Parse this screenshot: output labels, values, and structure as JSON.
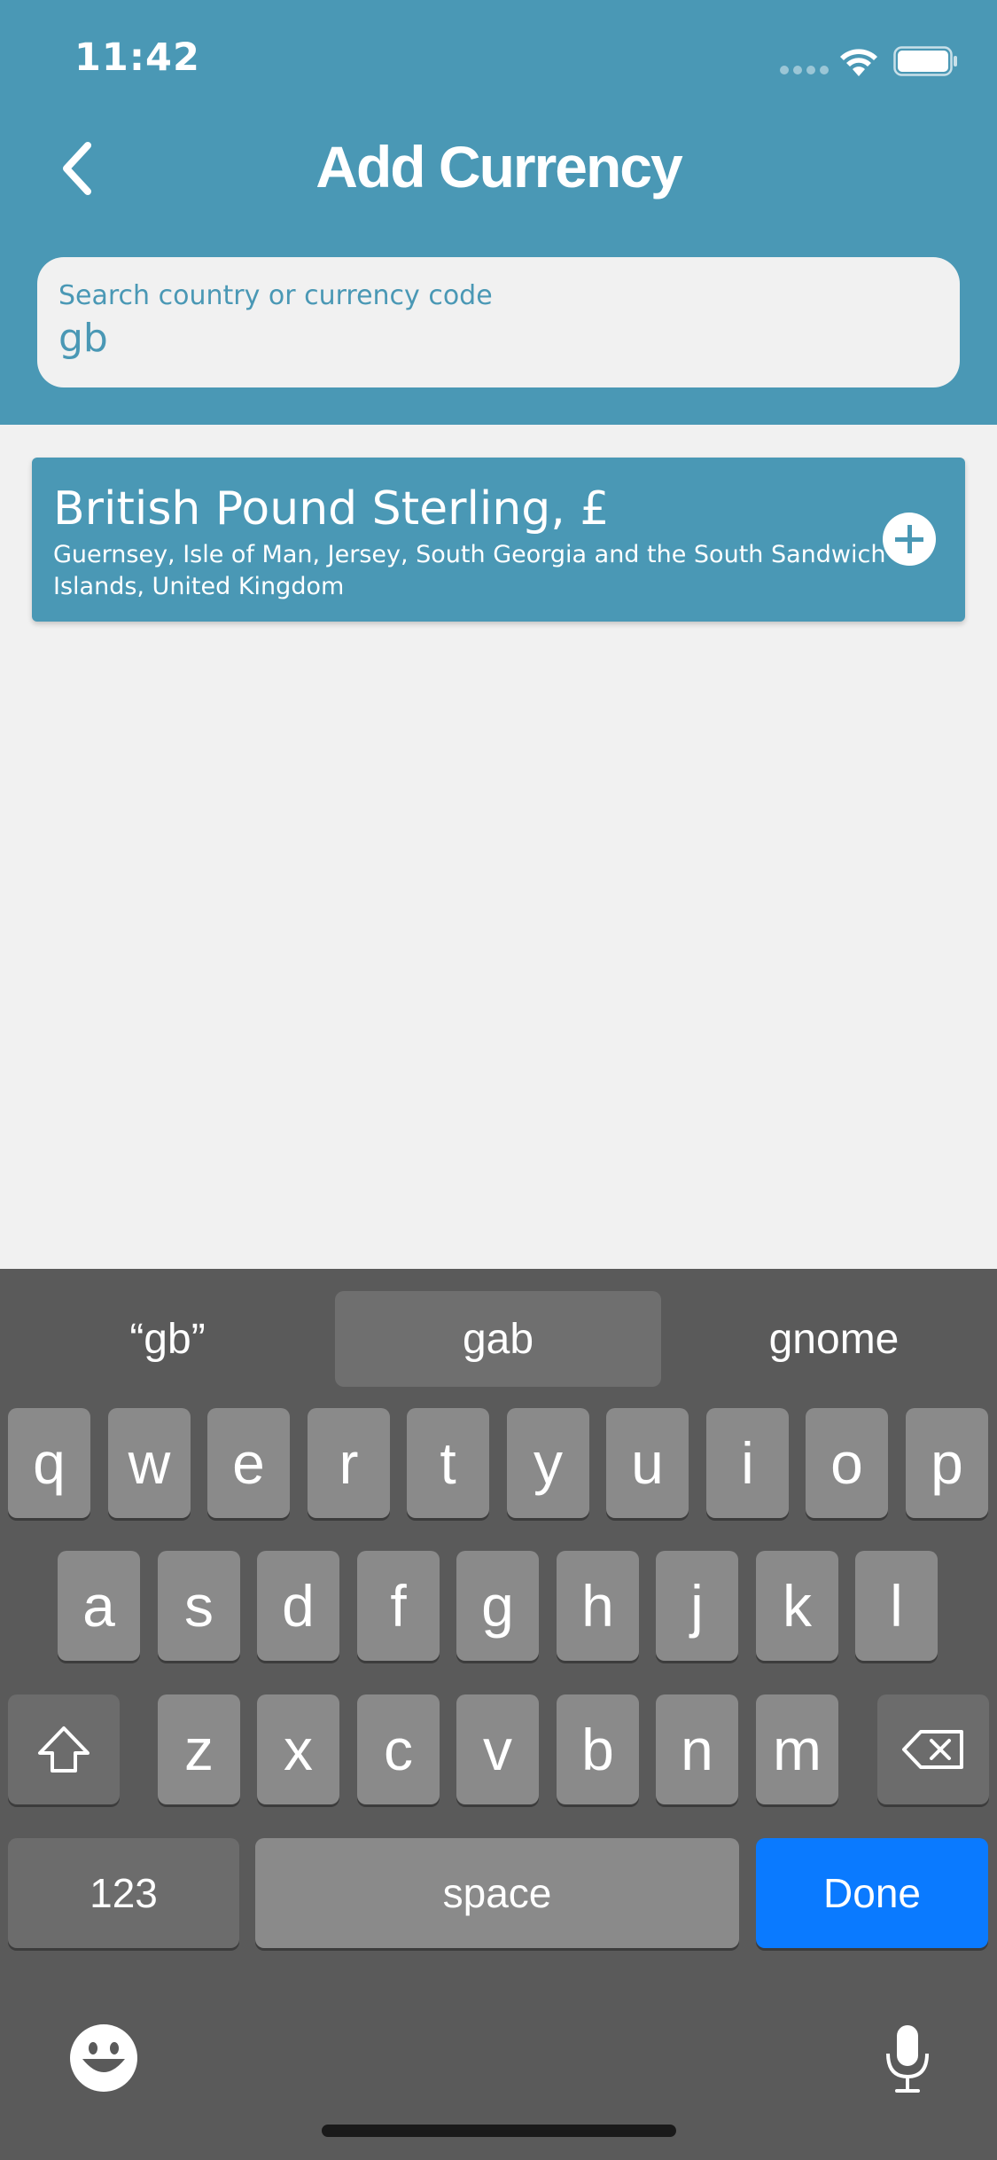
{
  "status_bar": {
    "time": "11:42"
  },
  "header": {
    "title": "Add Currency",
    "back_icon": "chevron-left-icon"
  },
  "search": {
    "label": "Search country or currency code",
    "value": "gb"
  },
  "results": [
    {
      "title": "British Pound Sterling, £",
      "countries": "Guernsey, Isle of Man, Jersey, South Georgia and the South Sandwich Islands, United Kingdom",
      "action_icon": "plus-circle-icon"
    }
  ],
  "keyboard": {
    "suggestions": [
      "“gb”",
      "gab",
      "gnome"
    ],
    "row1": [
      "q",
      "w",
      "e",
      "r",
      "t",
      "y",
      "u",
      "i",
      "o",
      "p"
    ],
    "row2": [
      "a",
      "s",
      "d",
      "f",
      "g",
      "h",
      "j",
      "k",
      "l"
    ],
    "row3": [
      "z",
      "x",
      "c",
      "v",
      "b",
      "n",
      "m"
    ],
    "numbers_label": "123",
    "space_label": "space",
    "done_label": "Done",
    "shift_icon": "shift-icon",
    "delete_icon": "backspace-icon",
    "emoji_icon": "emoji-icon",
    "mic_icon": "microphone-icon"
  },
  "colors": {
    "accent": "#4a98b5",
    "done": "#0a7aff",
    "keyboard_bg": "#5a5a5a",
    "key": "#8a8a8a"
  }
}
